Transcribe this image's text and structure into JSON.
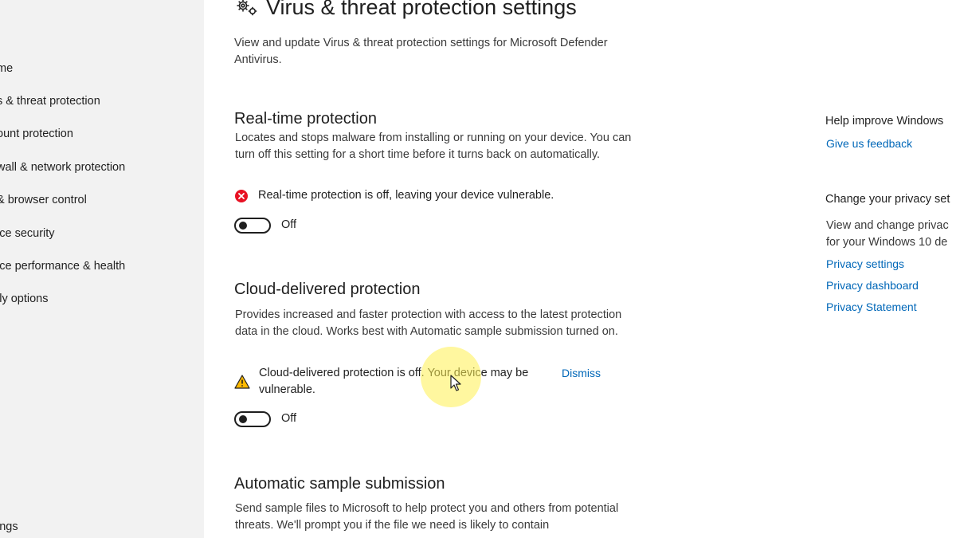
{
  "sidebar": {
    "items": [
      {
        "label": "me"
      },
      {
        "label": "s & threat protection"
      },
      {
        "label": "ount protection"
      },
      {
        "label": "wall & network protection"
      },
      {
        "label": " & browser control"
      },
      {
        "label": "ice security"
      },
      {
        "label": "ice performance & health"
      },
      {
        "label": "ily options"
      }
    ],
    "bottom_item": "ings"
  },
  "page": {
    "title": "Virus & threat protection settings",
    "description": "View and update Virus & threat protection settings for Microsoft Defender Antivirus."
  },
  "sections": {
    "realtime": {
      "title": "Real-time protection",
      "description": "Locates and stops malware from installing or running on your device. You can turn off this setting for a short time before it turns back on automatically.",
      "status": "Real-time protection is off, leaving your device vulnerable.",
      "toggle_label": "Off"
    },
    "cloud": {
      "title": "Cloud-delivered protection",
      "description": "Provides increased and faster protection with access to the latest protection data in the cloud. Works best with Automatic sample submission turned on.",
      "status": "Cloud-delivered protection is off. Your device may be vulnerable.",
      "dismiss": "Dismiss",
      "toggle_label": "Off"
    },
    "sample": {
      "title": "Automatic sample submission",
      "description": "Send sample files to Microsoft to help protect you and others from potential threats. We'll prompt you if the file we need is likely to contain"
    }
  },
  "right_panel": {
    "help_heading": "Help improve Windows",
    "feedback_link": "Give us feedback",
    "privacy_heading": "Change your privacy set",
    "privacy_text_1": "View and change privac",
    "privacy_text_2": "for your Windows 10 de",
    "privacy_links": [
      "Privacy settings",
      "Privacy dashboard",
      "Privacy Statement"
    ]
  },
  "colors": {
    "accent": "#0067b8",
    "error": "#e81123",
    "warning": "#ffb900",
    "sidebar_bg": "#f2f2f2"
  },
  "icons": {
    "title": "gear-icon",
    "error": "error-circle-icon",
    "warning": "warning-triangle-icon",
    "cursor": "mouse-cursor-icon"
  }
}
